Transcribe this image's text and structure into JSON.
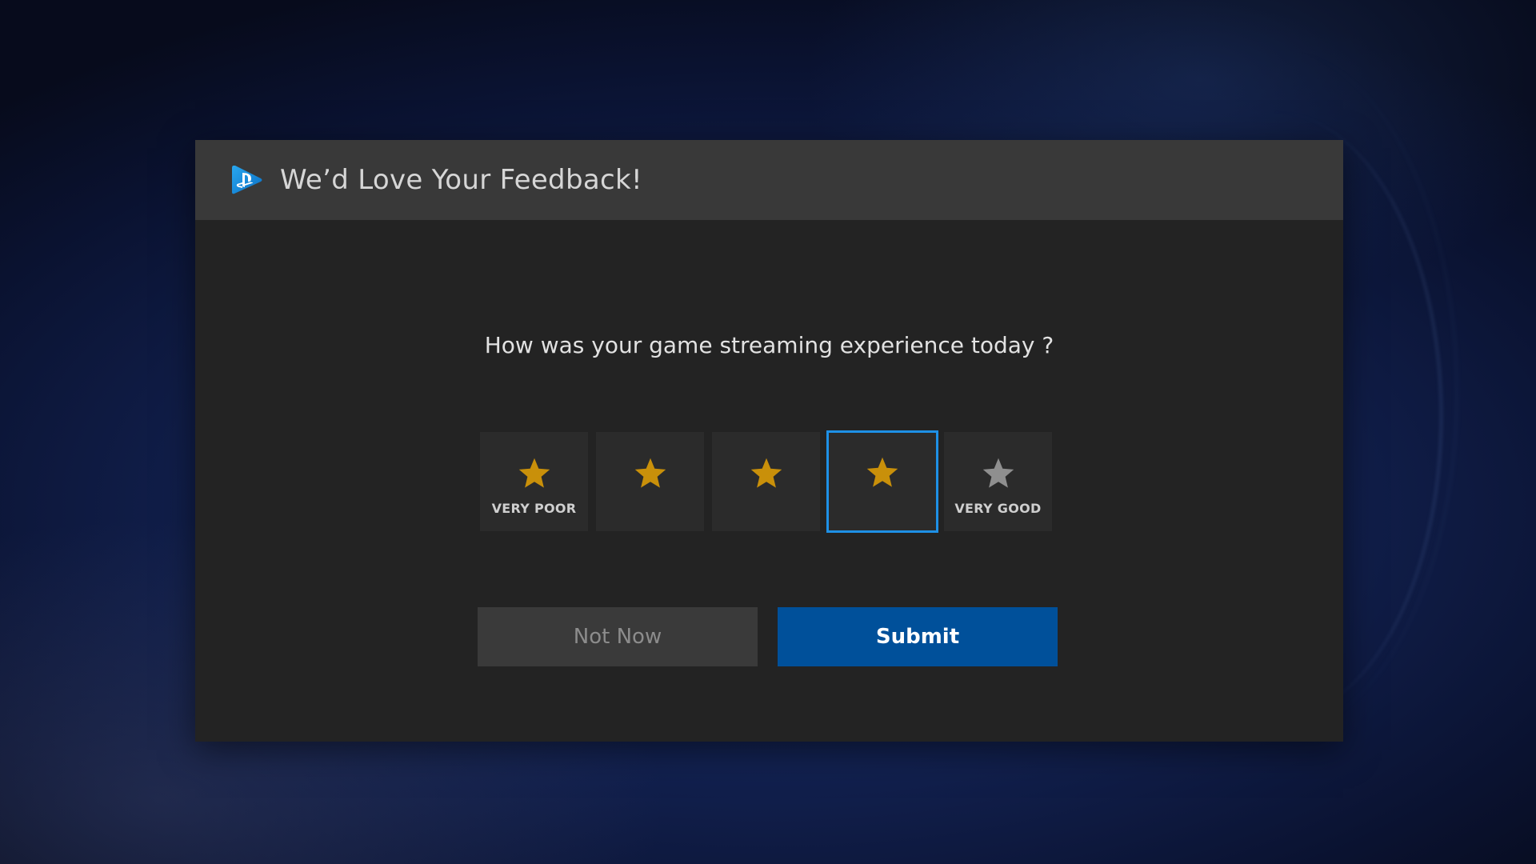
{
  "dialog": {
    "title": "We’d Love Your Feedback!",
    "logo_icon": "playstation-now-logo-icon",
    "question": "How was your game streaming experience today ?",
    "ratings": [
      {
        "label": "VERY POOR",
        "icon": "star-icon",
        "filled": true
      },
      {
        "label": "",
        "icon": "star-icon",
        "filled": true
      },
      {
        "label": "",
        "icon": "star-icon",
        "filled": true
      },
      {
        "label": "",
        "icon": "star-icon",
        "filled": true,
        "selected": true
      },
      {
        "label": "VERY GOOD",
        "icon": "star-icon",
        "filled": false
      }
    ],
    "selected_rating": 4,
    "not_now_label": "Not Now",
    "submit_label": "Submit"
  },
  "colors": {
    "star_filled": "#c9900a",
    "star_empty": "#8f8f8f",
    "focus_border": "#1e90e6",
    "submit_bg": "#00509a"
  }
}
